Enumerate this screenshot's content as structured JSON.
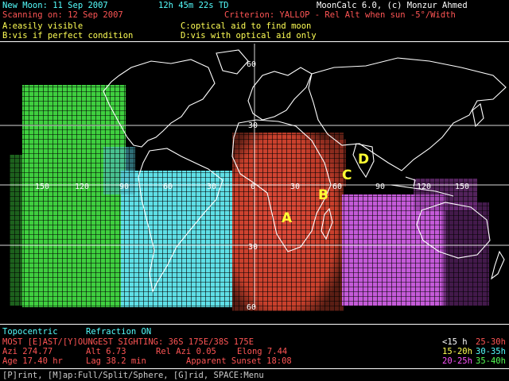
{
  "header": {
    "new_moon": "New Moon: 11 Sep 2007",
    "time": "12h 45m 22s TD",
    "app": "MoonCalc 6.0, (c) Monzur Ahmed",
    "scanning": "Scanning on: 12 Sep 2007",
    "criterion": "Criterion: YALLOP - Rel Alt when sun -5°/Width"
  },
  "key": {
    "a": "A:easily visible",
    "c": "C:optical aid to find moon",
    "b": "B:vis if perfect condition",
    "d": "D:vis with optical aid only"
  },
  "map": {
    "lon_labels": [
      "150",
      "120",
      "90",
      "60",
      "30",
      "0",
      "30",
      "60",
      "90",
      "120",
      "150"
    ],
    "lat_labels": [
      "60",
      "30",
      "30",
      "60"
    ],
    "regions": [
      "A",
      "B",
      "C",
      "D"
    ],
    "colors": {
      "green": "#3ccf3c",
      "cyan": "#5ee0e8",
      "red": "#d9403c",
      "magenta": "#c85ad8",
      "grid": "#f0f0f0"
    }
  },
  "footer": {
    "topocentric": "Topocentric",
    "refraction": "Refraction ON",
    "most": "MOST [E]AST/[Y]OUNGEST SIGHTING: 36S 175E/38S 175E",
    "azi": "Azi 274.77",
    "alt": "Alt 6.73",
    "rel_azi": "Rel Azi 0.05",
    "elong": "Elong 7.44",
    "age": "Age 17.40 hr",
    "lag": "Lag 38.2 min",
    "sunset": "Apparent Sunset 18:08",
    "menu": "[P]rint, [M]ap:Full/Split/Sphere, [G]rid, SPACE:Menu"
  },
  "legend": [
    {
      "label": "<15 h",
      "color": "#ffffff"
    },
    {
      "label": "25-30h",
      "color": "#ff5555"
    },
    {
      "label": "15-20h",
      "color": "#ffff55"
    },
    {
      "label": "30-35h",
      "color": "#55ffff"
    },
    {
      "label": "20-25h",
      "color": "#ff55ff"
    },
    {
      "label": "35-40h",
      "color": "#55ff55"
    }
  ]
}
